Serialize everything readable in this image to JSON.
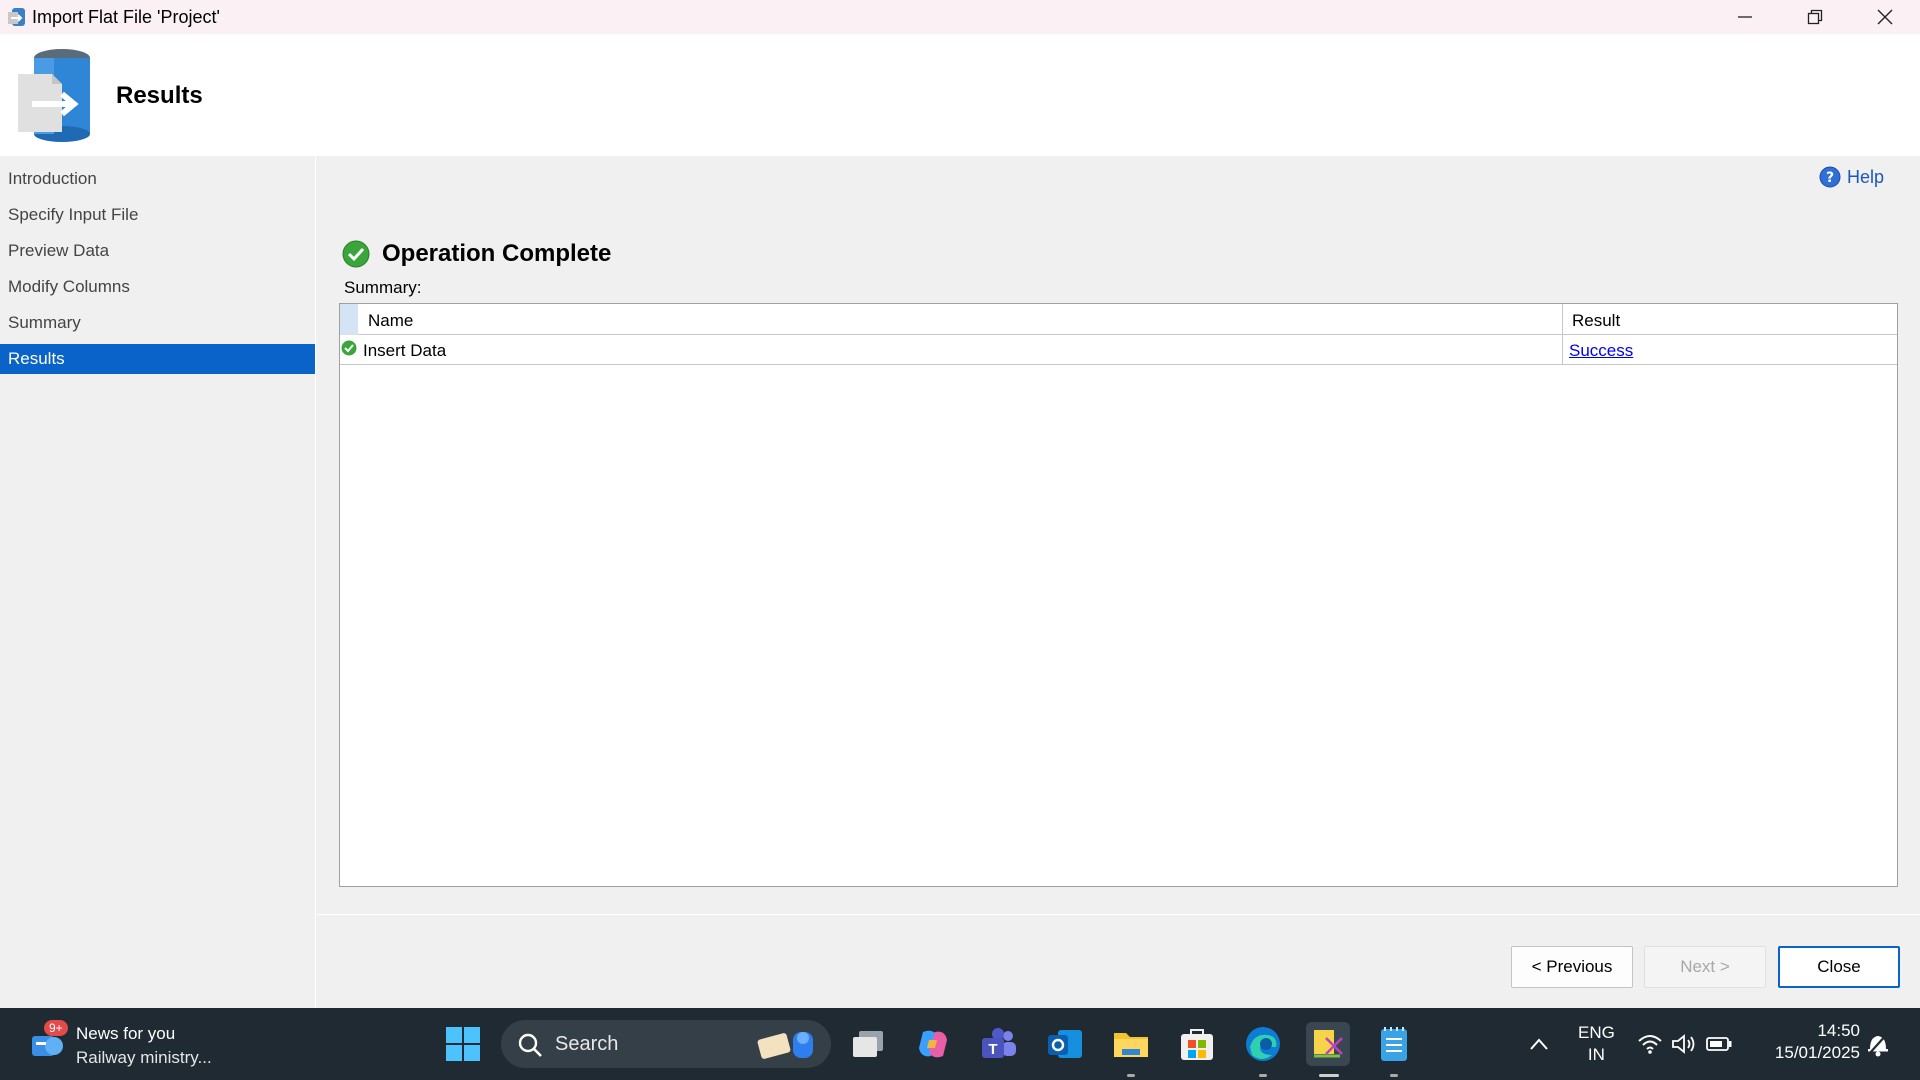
{
  "window": {
    "title": "Import Flat File 'Project'"
  },
  "header": {
    "title": "Results"
  },
  "sidebar": {
    "items": [
      {
        "label": "Introduction"
      },
      {
        "label": "Specify Input File"
      },
      {
        "label": "Preview Data"
      },
      {
        "label": "Modify Columns"
      },
      {
        "label": "Summary"
      },
      {
        "label": "Results"
      }
    ],
    "active_index": 5
  },
  "main": {
    "help_label": "Help",
    "operation_title": "Operation Complete",
    "summary_label": "Summary:",
    "table": {
      "columns": [
        "Name",
        "Result"
      ],
      "rows": [
        {
          "name": "Insert Data",
          "result": "Success"
        }
      ]
    }
  },
  "buttons": {
    "previous": "< Previous",
    "next": "Next >",
    "close": "Close"
  },
  "taskbar": {
    "news_title": "News for you",
    "news_subtitle": "Railway ministry...",
    "news_badge": "9+",
    "search_label": "Search",
    "lang_top": "ENG",
    "lang_bottom": "IN",
    "time": "14:50",
    "date": "15/01/2025"
  },
  "colors": {
    "accent": "#0a63c9",
    "success": "#3aa53a",
    "link": "#0000ee"
  }
}
